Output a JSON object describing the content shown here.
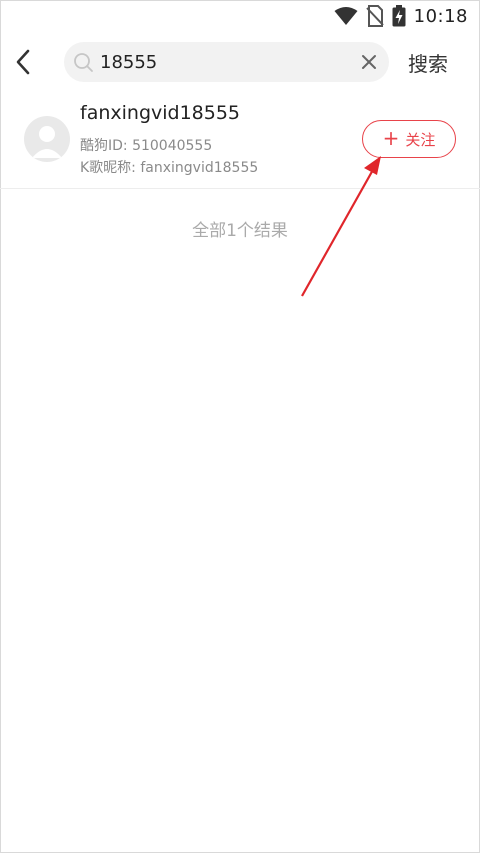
{
  "status_bar": {
    "time": "10:18"
  },
  "header": {
    "search_value": "18555",
    "search_button": "搜索"
  },
  "result": {
    "name": "fanxingvid18555",
    "kugou_id_line": "酷狗ID: 510040555",
    "k_nickname_line": "K歌昵称: fanxingvid18555",
    "follow_plus": "+",
    "follow_label": "关注"
  },
  "result_count": "全部1个结果",
  "colors": {
    "accent": "#e8434a",
    "annotation_arrow": "#e0262b"
  }
}
